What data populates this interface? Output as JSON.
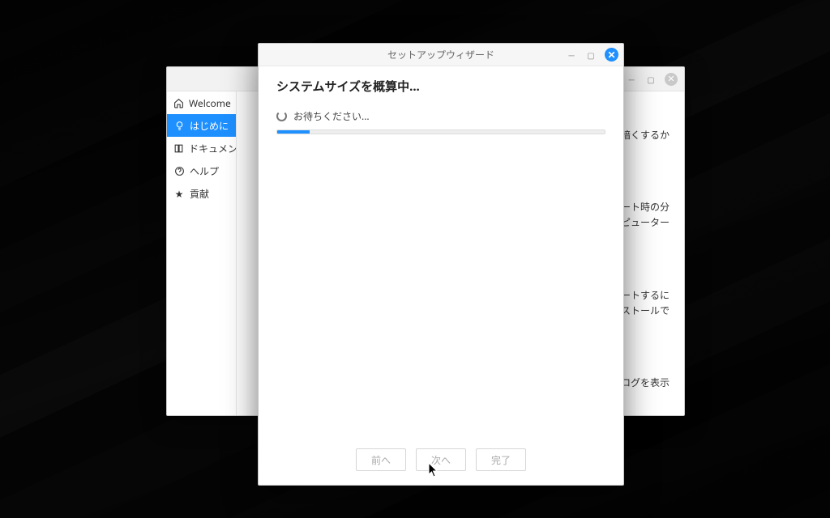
{
  "back_window": {
    "sidebar": {
      "items": [
        {
          "label": "Welcome"
        },
        {
          "label": "はじめに"
        },
        {
          "label": "ドキュメン"
        },
        {
          "label": "ヘルプ"
        },
        {
          "label": "貢献"
        }
      ]
    },
    "content": {
      "p1": "暗くするか",
      "p2": "ブート時の分\nンピューター",
      "p3": "ートするに\nンストールで",
      "p4": "イアログを表示"
    }
  },
  "wizard": {
    "title": "セットアップウィザード",
    "heading": "システムサイズを概算中...",
    "status": "お待ちください...",
    "buttons": {
      "back": "前へ",
      "next": "次へ",
      "finish": "完了"
    }
  }
}
